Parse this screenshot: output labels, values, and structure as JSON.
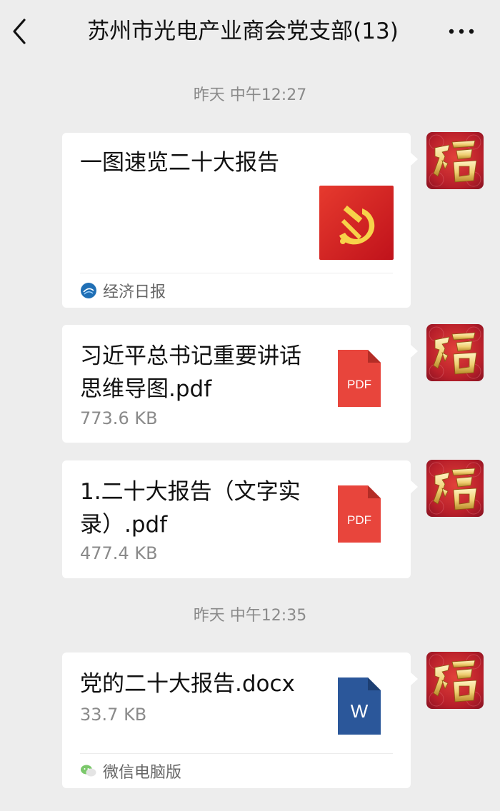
{
  "header": {
    "title": "苏州市光电产业商会党支部(13)",
    "back_icon": "chevron-left-icon",
    "more_icon": "more-dots-icon"
  },
  "messages": [
    {
      "timestamp": "昨天 中午12:27",
      "type": "link",
      "title": "一图速览二十大报告",
      "thumbnail": "party-emblem-image",
      "source": "经济日报"
    },
    {
      "type": "file",
      "filename": "习近平总书记重要讲话思维导图.pdf",
      "size": "773.6 KB",
      "icon_label": "PDF",
      "icon_color": "#e8453c"
    },
    {
      "type": "file",
      "filename": "1.二十大报告（文字实录）.pdf",
      "size": "477.4 KB",
      "icon_label": "PDF",
      "icon_color": "#e8453c"
    },
    {
      "timestamp": "昨天 中午12:35",
      "type": "file",
      "filename": "党的二十大报告.docx",
      "size": "33.7 KB",
      "icon_label": "W",
      "icon_color": "#2b579a",
      "source": "微信电脑版"
    }
  ],
  "colors": {
    "background": "#ededed",
    "bubble": "#ffffff",
    "timestamp": "#8a8a8a",
    "avatar_red": "#c0262c",
    "avatar_gold": "#f2d27a"
  }
}
